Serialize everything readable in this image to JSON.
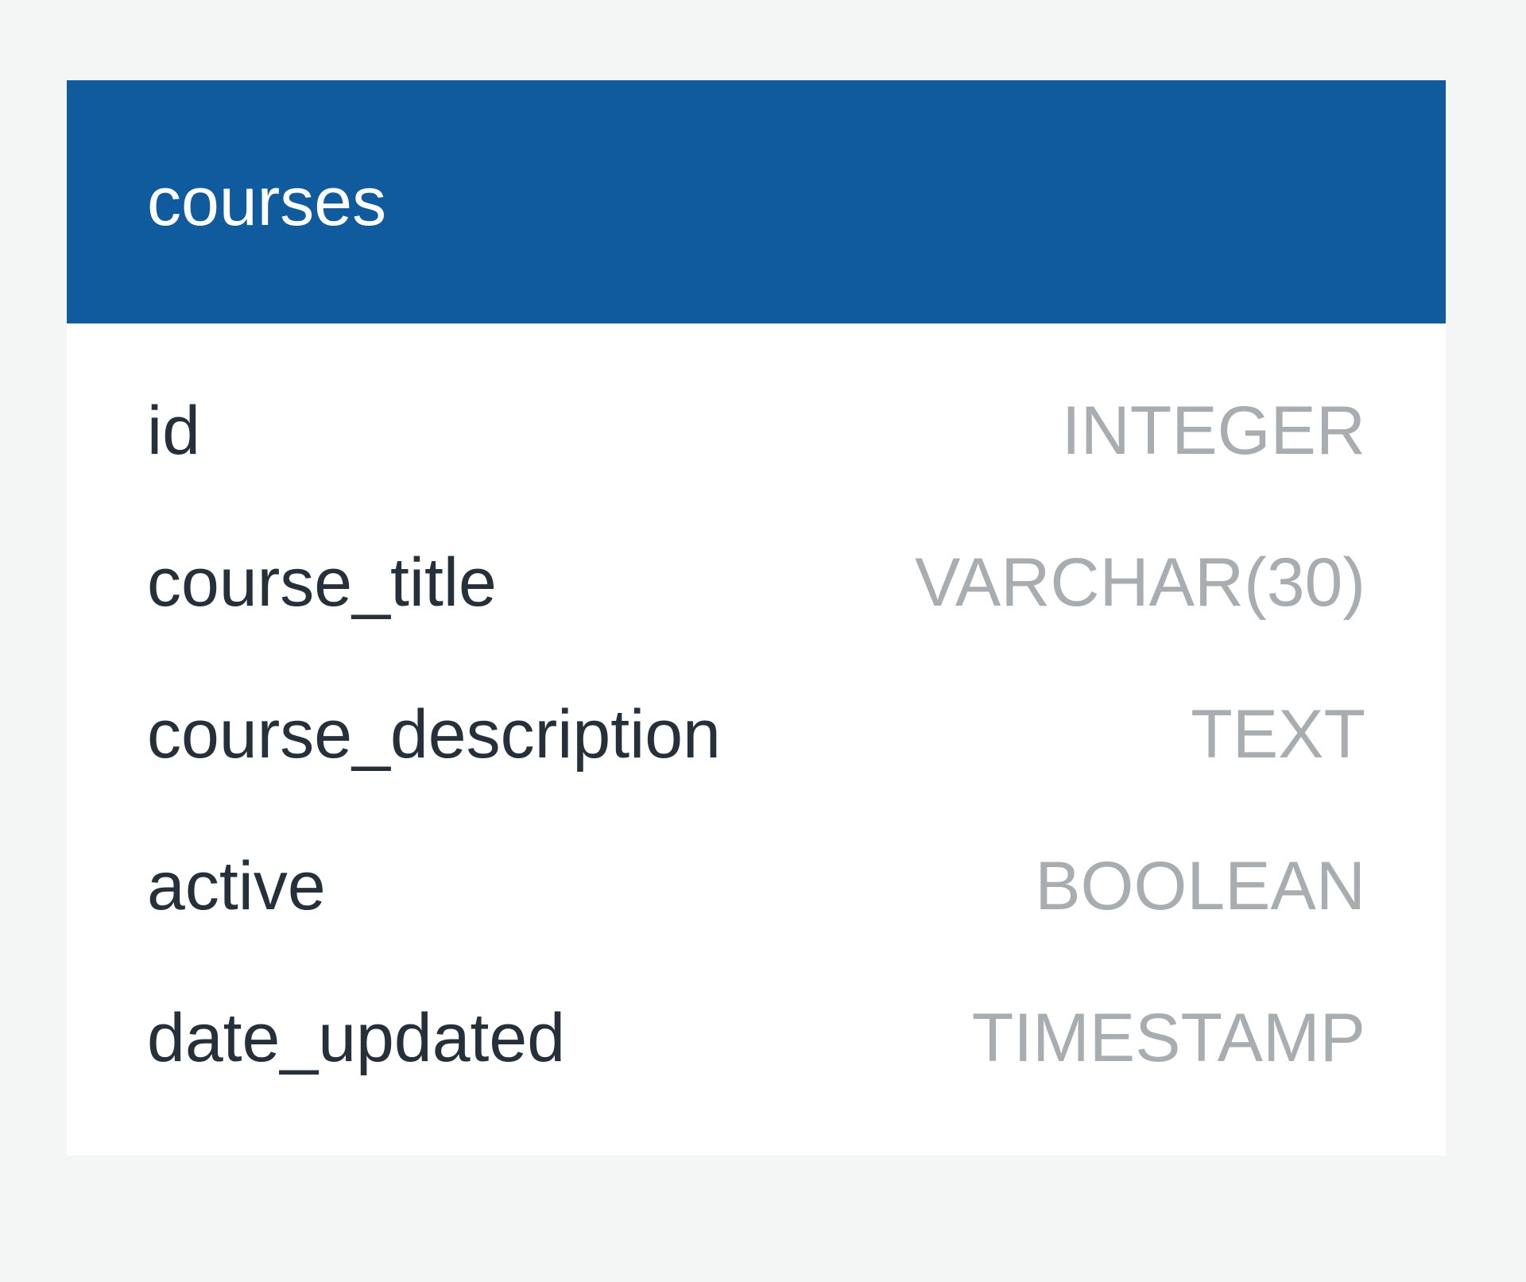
{
  "table": {
    "name": "courses",
    "header_color": "#0f5b9d",
    "fields": [
      {
        "name": "id",
        "type": "INTEGER"
      },
      {
        "name": "course_title",
        "type": "VARCHAR(30)"
      },
      {
        "name": "course_description",
        "type": "TEXT"
      },
      {
        "name": "active",
        "type": "BOOLEAN"
      },
      {
        "name": "date_updated",
        "type": "TIMESTAMP"
      }
    ]
  }
}
